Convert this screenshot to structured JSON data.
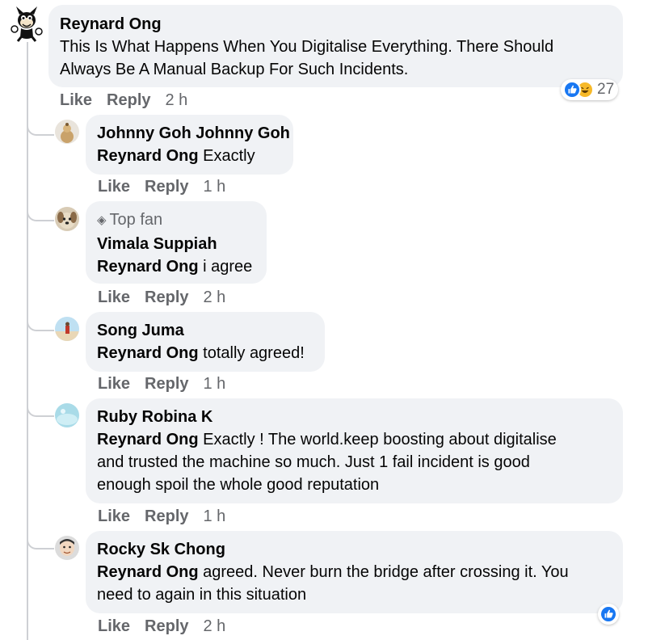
{
  "thread": {
    "root": {
      "author": "Reynard Ong",
      "line1": "This Is What Happens When You Digitalise Everything. There Should",
      "line2": "Always Be A Manual Backup For Such Incidents.",
      "like": "Like",
      "reply": "Reply",
      "time": "2 h",
      "reaction_count": "27",
      "reaction_icons": [
        "like-icon",
        "haha-icon"
      ]
    },
    "replies": [
      {
        "author": "Johnny Goh Johnny Goh",
        "mention": "Reynard Ong",
        "text": " Exactly",
        "like": "Like",
        "reply": "Reply",
        "time": "1 h"
      },
      {
        "badge": "Top fan",
        "author": "Vimala Suppiah",
        "mention": "Reynard Ong",
        "text": " i agree",
        "like": "Like",
        "reply": "Reply",
        "time": "2 h"
      },
      {
        "author": "Song Juma",
        "mention": "Reynard Ong",
        "text": " totally agreed!",
        "like": "Like",
        "reply": "Reply",
        "time": "1 h"
      },
      {
        "author": "Ruby Robina K",
        "mention": "Reynard Ong",
        "text_line1": " Exactly ! The world.keep boosting about digitalise",
        "text_line2": "and trusted the machine so much. Just 1 fail incident is good",
        "text_line3": "enough spoil the whole good reputation",
        "like": "Like",
        "reply": "Reply",
        "time": "1 h"
      },
      {
        "author": "Rocky Sk Chong",
        "mention": "Reynard Ong",
        "text_line1": " agreed. Never burn the bridge after crossing it. You",
        "text_line2": "need to again in this situation",
        "like": "Like",
        "reply": "Reply",
        "time": "2 h",
        "reaction_icons": [
          "like-icon"
        ]
      }
    ]
  },
  "colors": {
    "bubble": "#f0f2f5",
    "secondary_text": "#65676b",
    "like_blue": "#1877f2",
    "haha_yellow": "#f7b928",
    "thread_line": "#ced0d4"
  }
}
